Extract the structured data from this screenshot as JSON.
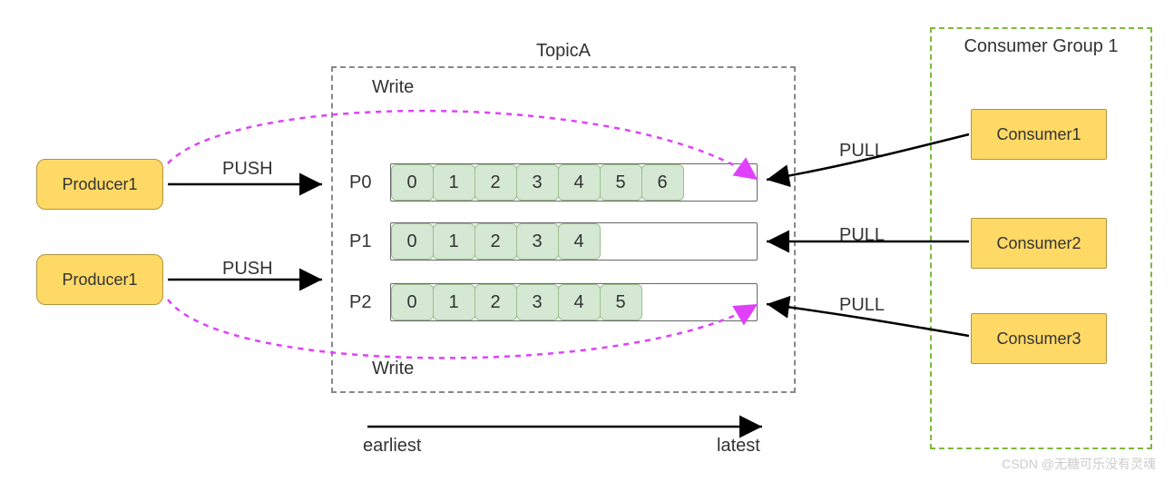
{
  "producers": [
    {
      "label": "Producer1"
    },
    {
      "label": "Producer1"
    }
  ],
  "push_labels": [
    "PUSH",
    "PUSH"
  ],
  "topic": {
    "title": "TopicA",
    "write_top": "Write",
    "write_bottom": "Write",
    "partitions": [
      {
        "name": "P0",
        "items": [
          "0",
          "1",
          "2",
          "3",
          "4",
          "5",
          "6"
        ],
        "capacity": 9
      },
      {
        "name": "P1",
        "items": [
          "0",
          "1",
          "2",
          "3",
          "4"
        ],
        "capacity": 9
      },
      {
        "name": "P2",
        "items": [
          "0",
          "1",
          "2",
          "3",
          "4",
          "5"
        ],
        "capacity": 9
      }
    ],
    "earliest": "earliest",
    "latest": "latest"
  },
  "pull_labels": [
    "PULL",
    "PULL",
    "PULL"
  ],
  "consumer_group": {
    "title": "Consumer Group 1",
    "consumers": [
      {
        "label": "Consumer1"
      },
      {
        "label": "Consumer2"
      },
      {
        "label": "Consumer3"
      }
    ]
  },
  "watermark": "CSDN @无糖可乐没有灵魂"
}
